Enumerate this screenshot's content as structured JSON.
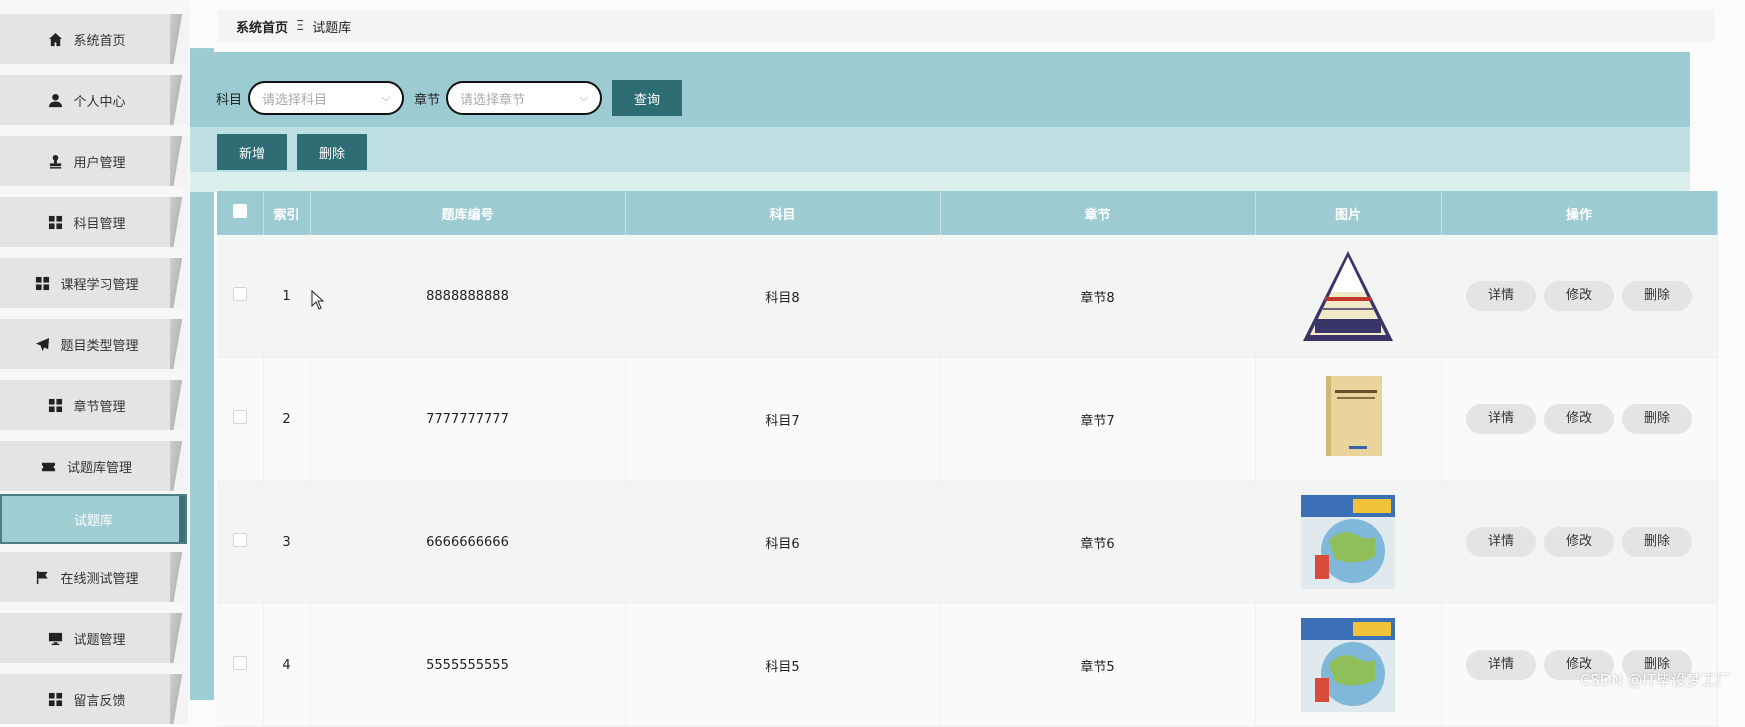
{
  "sidebar": {
    "items": [
      {
        "label": "系统首页",
        "icon": "home-icon"
      },
      {
        "label": "个人中心",
        "icon": "user-icon"
      },
      {
        "label": "用户管理",
        "icon": "user-stamp-icon"
      },
      {
        "label": "科目管理",
        "icon": "grid-icon"
      },
      {
        "label": "课程学习管理",
        "icon": "grid-icon"
      },
      {
        "label": "题目类型管理",
        "icon": "send-icon"
      },
      {
        "label": "章节管理",
        "icon": "grid-icon"
      },
      {
        "label": "试题库管理",
        "icon": "ticket-icon"
      },
      {
        "label": "在线测试管理",
        "icon": "flag-icon"
      },
      {
        "label": "试题管理",
        "icon": "monitor-icon"
      },
      {
        "label": "留言反馈",
        "icon": "grid-icon"
      }
    ],
    "active_sub": "试题库"
  },
  "breadcrumb": {
    "home": "系统首页",
    "separator": "Ξ",
    "current": "试题库"
  },
  "filters": {
    "subject_label": "科目",
    "subject_placeholder": "请选择科目",
    "chapter_label": "章节",
    "chapter_placeholder": "请选择章节",
    "query_button": "查询"
  },
  "actions": {
    "add_button": "新增",
    "delete_button": "删除"
  },
  "table": {
    "columns": [
      "索引",
      "题库编号",
      "科目",
      "章节",
      "图片",
      "操作"
    ],
    "rows": [
      {
        "index": "1",
        "code": "8888888888",
        "subject": "科目8",
        "chapter": "章节8",
        "image": "pyramid-chart-image"
      },
      {
        "index": "2",
        "code": "7777777777",
        "subject": "科目7",
        "chapter": "章节7",
        "image": "yellow-book-cover-image"
      },
      {
        "index": "3",
        "code": "6666666666",
        "subject": "科目6",
        "chapter": "章节6",
        "image": "math-book-cover-image"
      },
      {
        "index": "4",
        "code": "5555555555",
        "subject": "科目5",
        "chapter": "章节5",
        "image": "math-book-cover-image"
      }
    ],
    "row_buttons": {
      "detail": "详情",
      "edit": "修改",
      "delete": "删除"
    }
  },
  "watermark": "CSDN @IT毕设梦工厂",
  "colors": {
    "accent": "#9ccbd1",
    "button": "#2e6d74",
    "active_border": "#4a7f86"
  }
}
